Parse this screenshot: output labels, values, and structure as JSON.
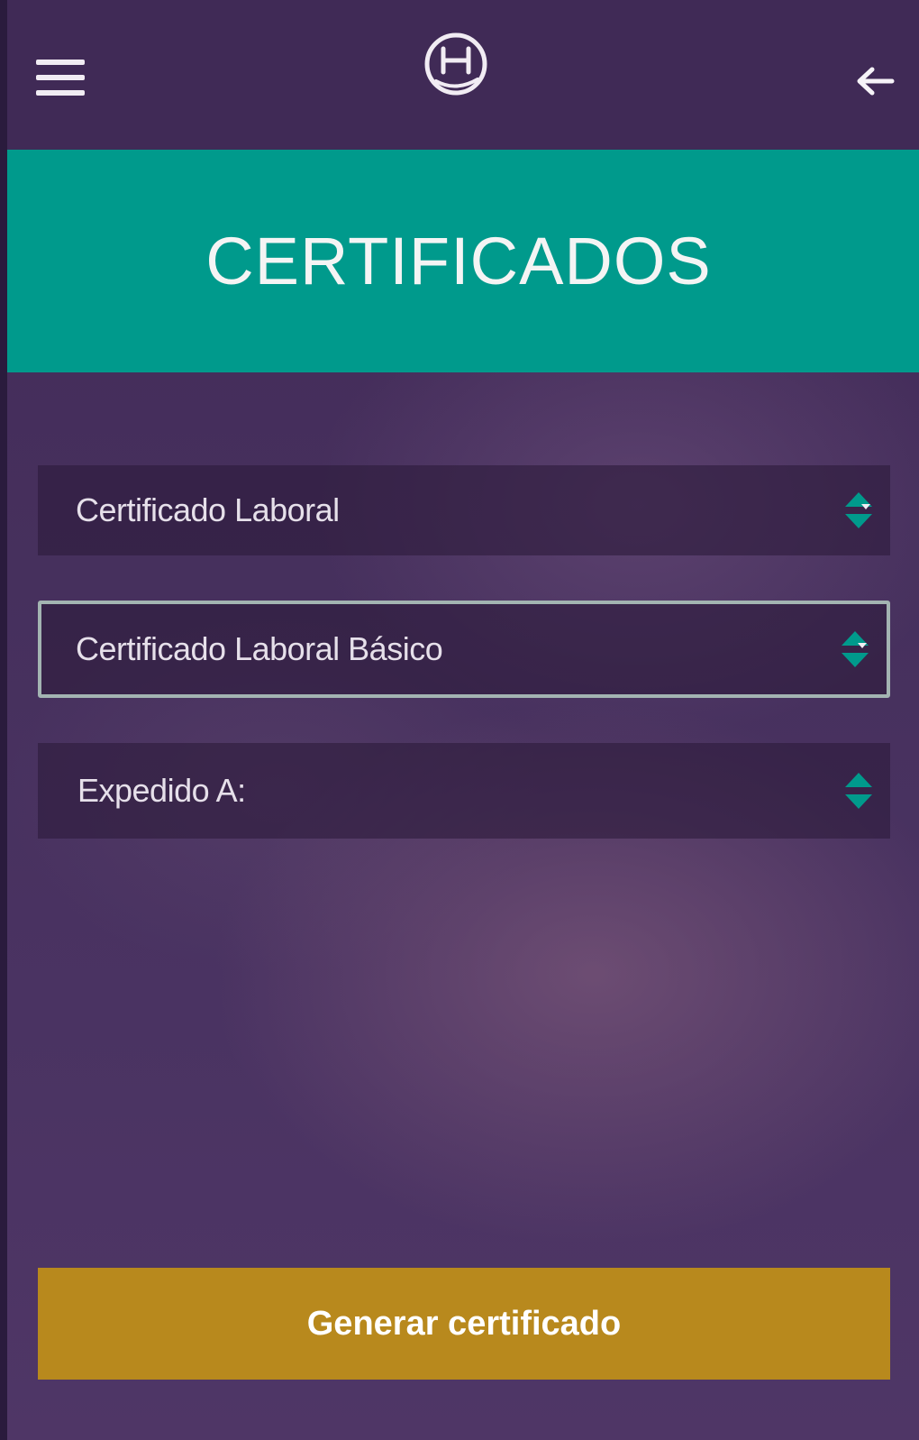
{
  "header": {
    "menu_icon": "hamburger-menu-icon",
    "logo_icon": "circled-h-logo",
    "back_icon": "arrow-left-icon"
  },
  "banner": {
    "title": "CERTIFICADOS"
  },
  "form": {
    "certificate_type": {
      "value": "Certificado Laboral"
    },
    "certificate_subtype": {
      "value": "Certificado Laboral Básico"
    },
    "addressed_to": {
      "value": "Expedido A:"
    }
  },
  "actions": {
    "generate_label": "Generar certificado"
  },
  "colors": {
    "header_bg": "#402a56",
    "banner_bg": "#009a8c",
    "button_bg": "#b8891d",
    "arrow_accent": "#009a8c"
  }
}
